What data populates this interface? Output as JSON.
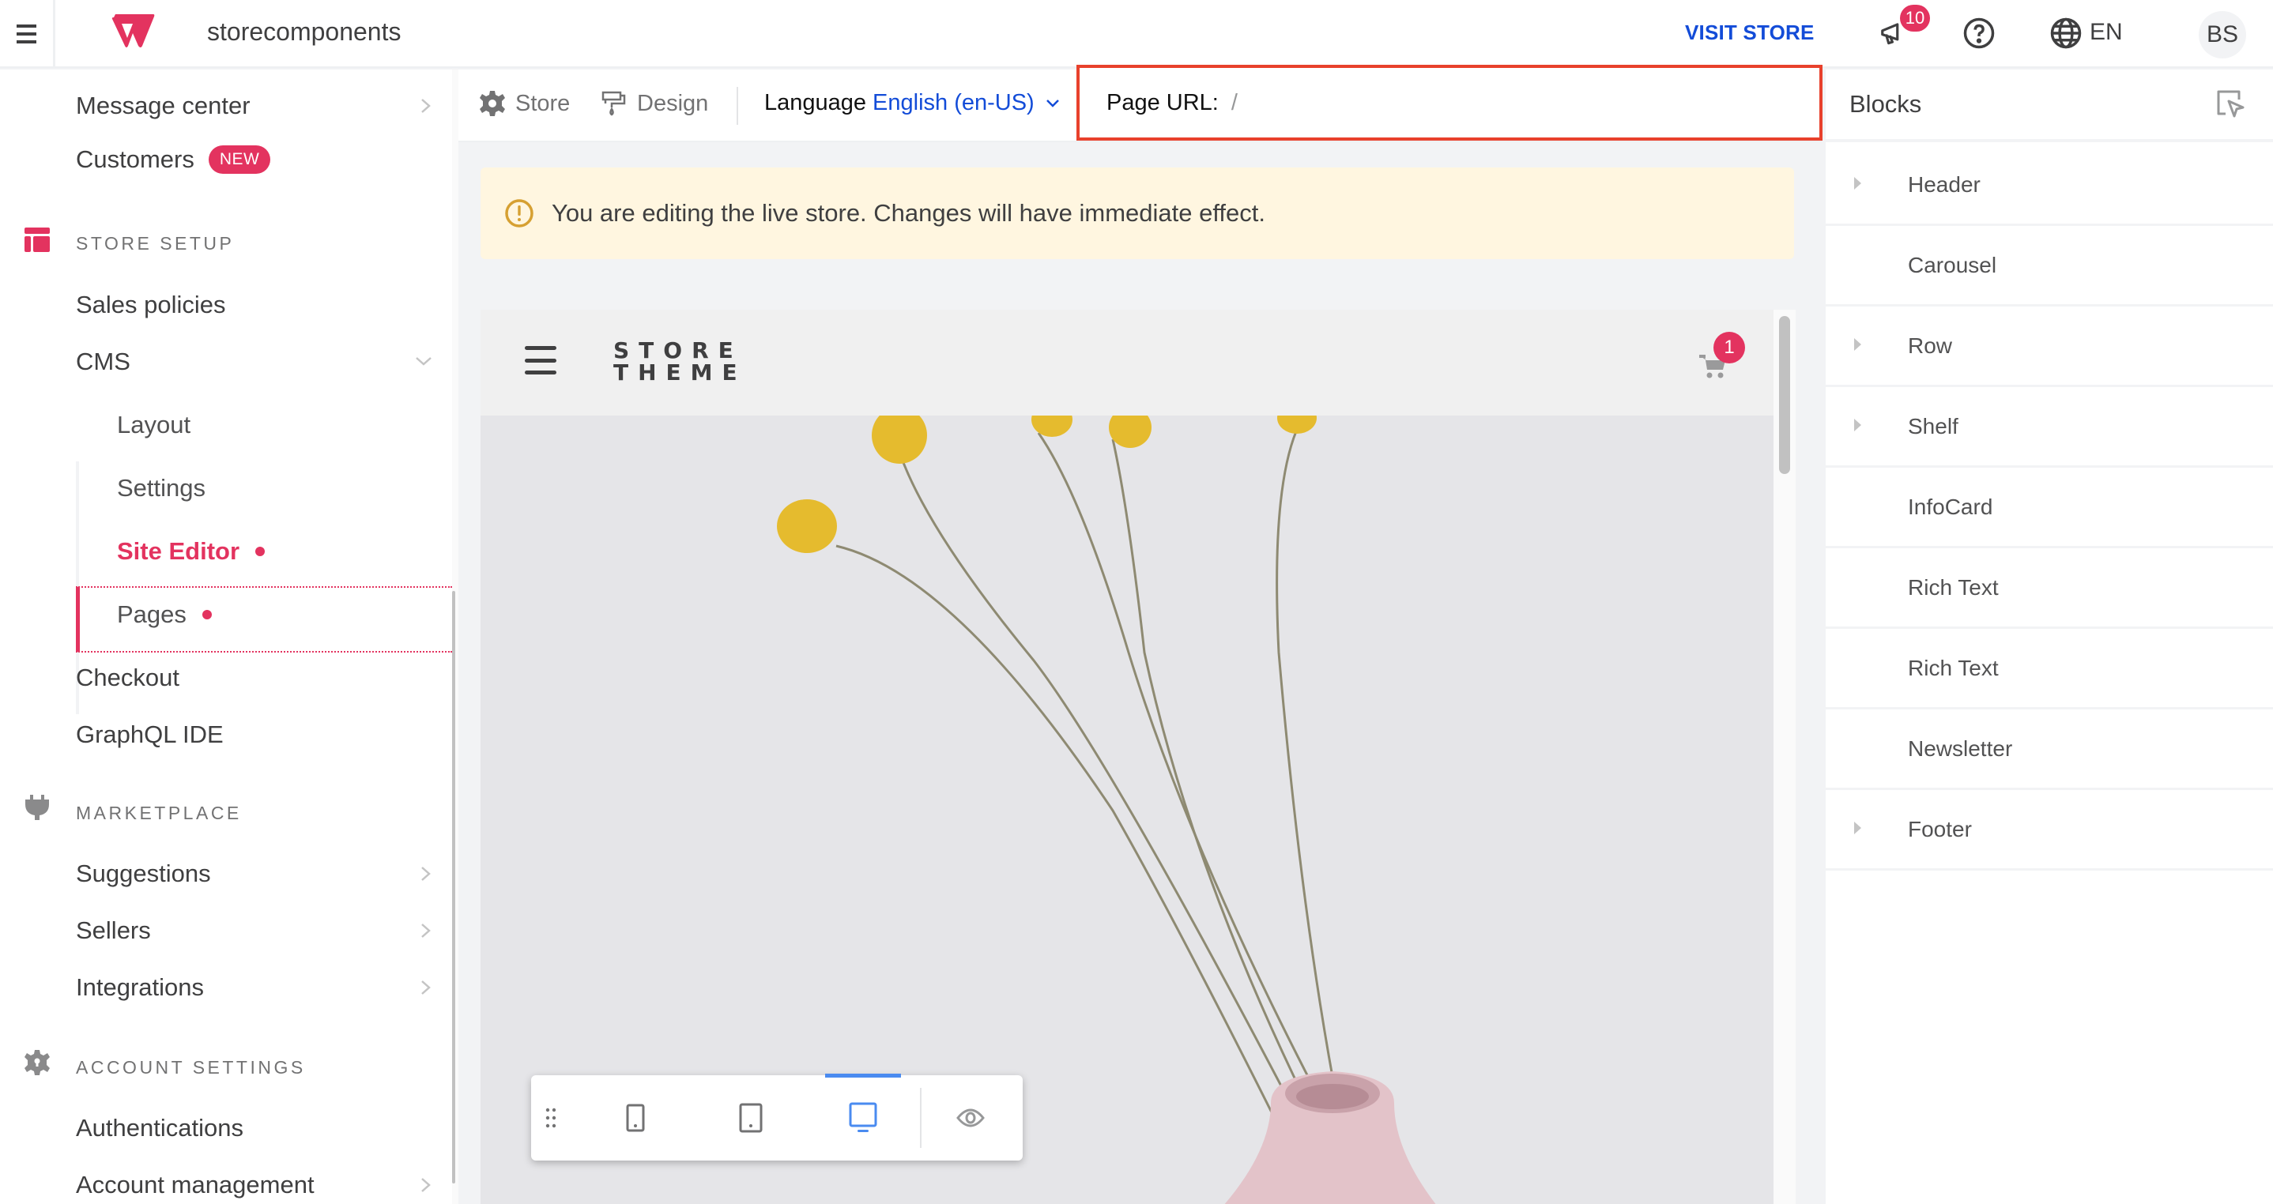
{
  "topbar": {
    "account_name": "storecomponents",
    "visit_store": "VISIT STORE",
    "notifications_count": "10",
    "language": "EN",
    "user_initials": "BS",
    "icons": [
      "hamburger-icon",
      "vtex-logo",
      "megaphone-icon",
      "help-icon",
      "globe-icon"
    ]
  },
  "sidebar": {
    "top_items": [
      {
        "label": "Message center",
        "chevron": "right"
      },
      {
        "label": "Customers",
        "badge": "NEW"
      }
    ],
    "sections": [
      {
        "title": "STORE SETUP",
        "icon": "store-setup-icon",
        "items": [
          {
            "label": "Sales policies"
          },
          {
            "label": "CMS",
            "chevron": "down",
            "expanded": true,
            "children": [
              {
                "label": "Layout"
              },
              {
                "label": "Settings"
              },
              {
                "label": "Site Editor",
                "active": true,
                "dot": true
              },
              {
                "label": "Pages",
                "dot": true
              }
            ]
          },
          {
            "label": "Checkout"
          },
          {
            "label": "GraphQL IDE"
          }
        ]
      },
      {
        "title": "MARKETPLACE",
        "icon": "plug-icon",
        "items": [
          {
            "label": "Suggestions",
            "chevron": "right"
          },
          {
            "label": "Sellers",
            "chevron": "right"
          },
          {
            "label": "Integrations",
            "chevron": "right"
          }
        ]
      },
      {
        "title": "ACCOUNT SETTINGS",
        "icon": "gear-lock-icon",
        "items": [
          {
            "label": "Authentications"
          },
          {
            "label": "Account management",
            "chevron": "right"
          }
        ]
      }
    ]
  },
  "toolbar": {
    "store_label": "Store",
    "design_label": "Design",
    "language_label": "Language",
    "language_value": "English (en-US)",
    "page_url_label": "Page URL:",
    "page_url_value": "/"
  },
  "warning": {
    "text": "You are editing the live store. Changes will have immediate effect."
  },
  "preview": {
    "store_logo_line1": "STORE",
    "store_logo_line2": "THEME",
    "cart_count": "1",
    "device_modes": [
      "mobile",
      "tablet",
      "desktop"
    ],
    "active_device": "desktop",
    "hero_image": "dried flowers in pink vase"
  },
  "blocks_panel": {
    "title": "Blocks",
    "blocks": [
      {
        "label": "Header",
        "expandable": true
      },
      {
        "label": "Carousel",
        "expandable": false
      },
      {
        "label": "Row",
        "expandable": true
      },
      {
        "label": "Shelf",
        "expandable": true
      },
      {
        "label": "InfoCard",
        "expandable": false
      },
      {
        "label": "Rich Text",
        "expandable": false
      },
      {
        "label": "Rich Text",
        "expandable": false
      },
      {
        "label": "Newsletter",
        "expandable": false
      },
      {
        "label": "Footer",
        "expandable": true
      }
    ]
  },
  "colors": {
    "brand": "#e3335f",
    "link": "#134cd8",
    "highlight_border": "#e8412c",
    "warning_bg": "#fff6e0",
    "warning_icon": "#d6a032",
    "active_device": "#4a8bf0"
  }
}
